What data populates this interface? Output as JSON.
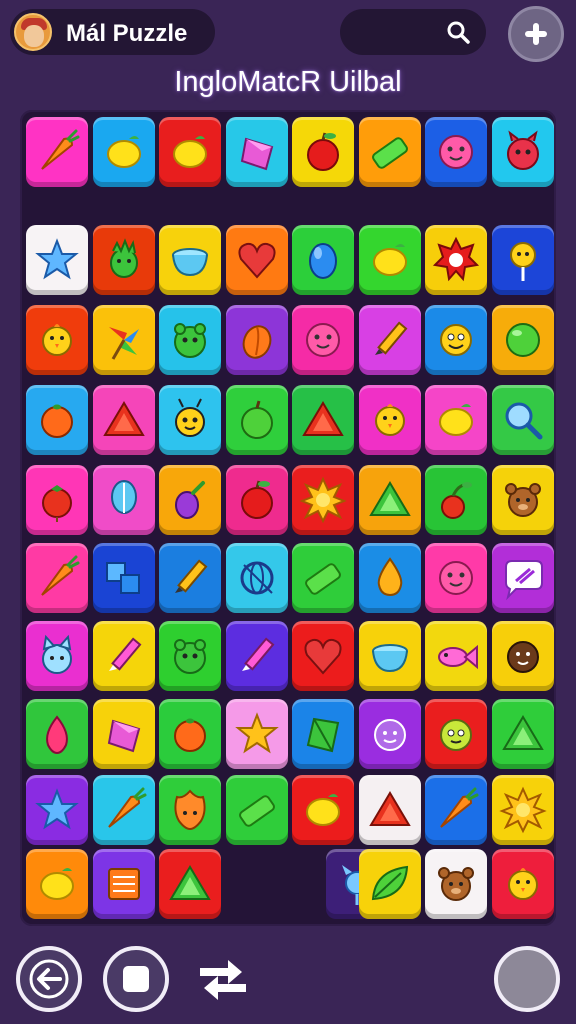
{
  "header": {
    "app_name": "Mál Puzzle",
    "level_title": "IngloMatcR Uilbal",
    "avatar_icon": "player-avatar",
    "search_icon": "search-icon",
    "add_icon": "plus-icon"
  },
  "colors": {
    "background": "#3a2556",
    "board": "#241437",
    "pill": "#231634"
  },
  "board": {
    "columns": 8,
    "rows": [
      [
        [
          "#ff33c4",
          "carrot"
        ],
        [
          "#1aa8f0",
          "lemon"
        ],
        [
          "#e81e1e",
          "lemon"
        ],
        [
          "#27c8e8",
          "prism"
        ],
        [
          "#f5d808",
          "apple"
        ],
        [
          "#ff9d0a",
          "bar"
        ],
        [
          "#1c5fe6",
          "face-pink"
        ],
        [
          "#22c8ee",
          "devil"
        ]
      ],
      [
        [
          "#f7f3f5",
          "star"
        ],
        [
          "#e83a0a",
          "dragon"
        ],
        [
          "#f7d20c",
          "bowl"
        ],
        [
          "#ff7a12",
          "heart"
        ],
        [
          "#2ccf3a",
          "egg"
        ],
        [
          "#34d62e",
          "lemon"
        ],
        [
          "#f7ce0a",
          "spike-flower"
        ],
        [
          "#1c45d8",
          "lollipop"
        ]
      ],
      [
        [
          "#f03c0c",
          "chick"
        ],
        [
          "#fbc10a",
          "pinwheel"
        ],
        [
          "#26c2ea",
          "green-monster"
        ],
        [
          "#8d35d8",
          "peach"
        ],
        [
          "#f52ba6",
          "face-pink"
        ],
        [
          "#d840e4",
          "pencil"
        ],
        [
          "#1b8ae8",
          "smiley"
        ],
        [
          "#f7ac0a",
          "green-ball"
        ]
      ],
      [
        [
          "#27a9f0",
          "orange"
        ],
        [
          "#f545b9",
          "triangle-red"
        ],
        [
          "#2ec3ee",
          "bee"
        ],
        [
          "#2fcf3c",
          "apple-green"
        ],
        [
          "#26c047",
          "triangle-red"
        ],
        [
          "#f030c6",
          "chick"
        ],
        [
          "#f545c8",
          "lemon"
        ],
        [
          "#34c946",
          "magnifier"
        ]
      ],
      [
        [
          "#ff36b6",
          "tomato"
        ],
        [
          "#f04cc8",
          "balloon"
        ],
        [
          "#f8a70a",
          "eggplant"
        ],
        [
          "#ef2b8e",
          "apple"
        ],
        [
          "#ea1e1e",
          "sun-flower"
        ],
        [
          "#f7a30c",
          "triangle-green"
        ],
        [
          "#28c436",
          "cherry"
        ],
        [
          "#f5d20a",
          "bear"
        ]
      ],
      [
        [
          "#ff3aa4",
          "carrot"
        ],
        [
          "#1a44d4",
          "cubes"
        ],
        [
          "#1b7ee0",
          "pencil"
        ],
        [
          "#34c8ea",
          "globe"
        ],
        [
          "#2fcd3a",
          "bar"
        ],
        [
          "#1b8de6",
          "drop-fire"
        ],
        [
          "#ff3aa8",
          "face-pink"
        ],
        [
          "#b22ed8",
          "chat"
        ]
      ],
      [
        [
          "#ea2fd0",
          "cat-face"
        ],
        [
          "#f5d50a",
          "pencil-pink"
        ],
        [
          "#2ecf2f",
          "green-monster"
        ],
        [
          "#5c2de0",
          "pencil-pink"
        ],
        [
          "#ec1c1c",
          "heart"
        ],
        [
          "#f7d20a",
          "bowl"
        ],
        [
          "#f2d80e",
          "fish"
        ],
        [
          "#f7cf0a",
          "coconut"
        ]
      ],
      [
        [
          "#30c63c",
          "berry"
        ],
        [
          "#f7d20a",
          "prism"
        ],
        [
          "#2bcc3c",
          "orange"
        ],
        [
          "#f59ae8",
          "star-gold"
        ],
        [
          "#1b84e8",
          "prism-green"
        ],
        [
          "#9a2de0",
          "face-purple"
        ],
        [
          "#ea1e1e",
          "lime-face"
        ],
        [
          "#2fcd3a",
          "triangle-green"
        ]
      ],
      [
        [
          "#8a2ce2",
          "star"
        ],
        [
          "#29c6ea",
          "carrot"
        ],
        [
          "#2fcd3a",
          "flame-face"
        ],
        [
          "#2fcd3a",
          "bar"
        ],
        [
          "#ec1c1c",
          "lemon"
        ],
        [
          "#f5f0f2",
          "triangle-red"
        ],
        [
          "#1b6fe8",
          "carrot"
        ],
        [
          "#f7d20a",
          "sun-flower"
        ]
      ],
      [
        [
          "#ff8a0a",
          "lemon"
        ],
        [
          "#7d35e6",
          "book"
        ],
        [
          "#ea1e1e",
          "triangle-green"
        ],
        null,
        [
          "#3d1f78",
          "blue-flower"
        ],
        [
          "#f7d20a",
          "leaf"
        ],
        [
          "#f7f3f5",
          "bear"
        ],
        [
          "#ee1e3c",
          "chick"
        ]
      ]
    ]
  }
}
